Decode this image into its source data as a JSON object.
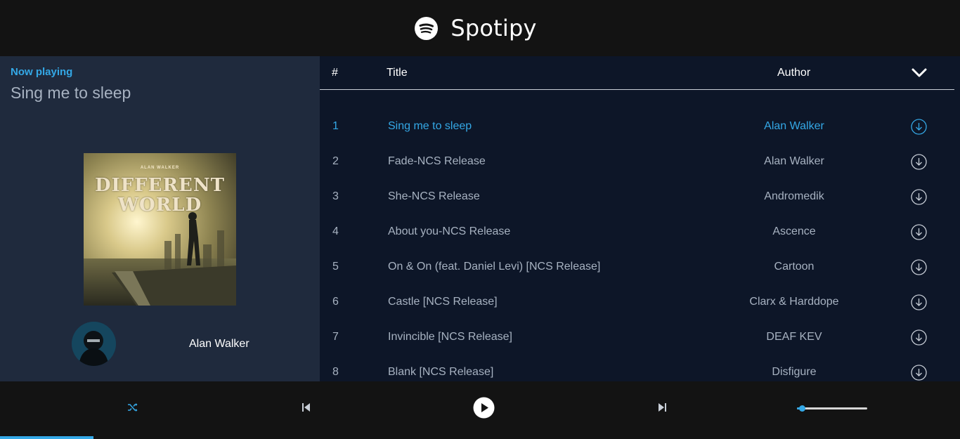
{
  "app": {
    "title": "Spotipy"
  },
  "now_playing": {
    "label": "Now playing",
    "title": "Sing me to sleep",
    "artist": "Alan Walker",
    "cover": {
      "brand_text": "ALAN WALKER",
      "title_line1": "DIFFERENT",
      "title_line2": "WORLD"
    }
  },
  "table": {
    "headers": {
      "number": "#",
      "title": "Title",
      "author": "Author"
    },
    "toggle_icon": "chevron-down-icon",
    "download_icon": "download-icon",
    "active_index": 0,
    "rows": [
      {
        "number": "1",
        "title": "Sing me to sleep",
        "author": "Alan Walker"
      },
      {
        "number": "2",
        "title": "Fade-NCS Release",
        "author": "Alan Walker"
      },
      {
        "number": "3",
        "title": "She-NCS Release",
        "author": "Andromedik"
      },
      {
        "number": "4",
        "title": "About you-NCS Release",
        "author": "Ascence"
      },
      {
        "number": "5",
        "title": "On & On (feat. Daniel Levi) [NCS Release]",
        "author": "Cartoon"
      },
      {
        "number": "6",
        "title": "Castle [NCS Release]",
        "author": "Clarx & Harddope"
      },
      {
        "number": "7",
        "title": "Invincible [NCS Release]",
        "author": "DEAF KEV"
      },
      {
        "number": "8",
        "title": "Blank [NCS Release]",
        "author": "Disfigure"
      }
    ]
  },
  "player": {
    "controls": {
      "shuffle_icon": "shuffle-icon",
      "previous_icon": "skip-previous-icon",
      "play_icon": "play-icon",
      "next_icon": "skip-next-icon"
    },
    "volume_level": 0.07,
    "track_progress": 0.097
  },
  "colors": {
    "accent": "#34a8e6",
    "header_bg": "#131313",
    "left_panel_bg": "#1f2a3d",
    "list_bg": "#0d1628",
    "muted_text": "#a7b2c1"
  }
}
